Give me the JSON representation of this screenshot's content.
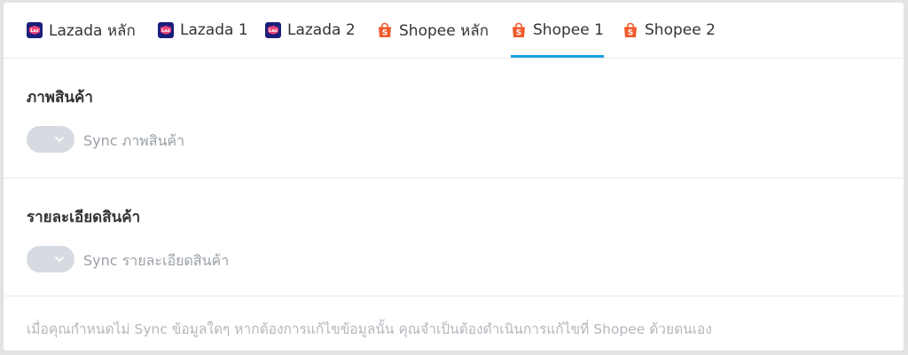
{
  "tabs": [
    {
      "label": "Lazada หลัก",
      "icon": "lazada-icon",
      "active": false
    },
    {
      "label": "Lazada 1",
      "icon": "lazada-icon",
      "active": false
    },
    {
      "label": "Lazada 2",
      "icon": "lazada-icon",
      "active": false
    },
    {
      "label": "Shopee หลัก",
      "icon": "shopee-icon",
      "active": false
    },
    {
      "label": "Shopee 1",
      "icon": "shopee-icon",
      "active": true
    },
    {
      "label": "Shopee 2",
      "icon": "shopee-icon",
      "active": false
    }
  ],
  "sections": {
    "images": {
      "title": "ภาพสินค้า",
      "toggle_label": "Sync ภาพสินค้า",
      "toggle_on": false
    },
    "details": {
      "title": "รายละเอียดสินค้า",
      "toggle_label": "Sync รายละเอียดสินค้า",
      "toggle_on": false
    }
  },
  "note": "เมื่อคุณกำหนดไม่ Sync ข้อมูลใดๆ หากต้องการแก้ไขข้อมูลนั้น คุณจำเป็นต้องดำเนินการแก้ไขที่ Shopee ด้วยตนเอง",
  "colors": {
    "active_tab_underline": "#1a9fe0",
    "lazada_bg": "#1b1f7a",
    "shopee_orange": "#f05a2a",
    "toggle_off": "#d5dbe0"
  }
}
